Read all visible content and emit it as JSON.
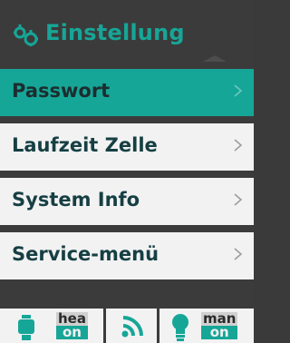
{
  "header": {
    "title": "Einstellung",
    "icon": "gears-icon"
  },
  "menu": {
    "items": [
      {
        "label": "Passwort",
        "active": true
      },
      {
        "label": "Laufzeit Zelle",
        "active": false
      },
      {
        "label": "System Info",
        "active": false
      },
      {
        "label": "Service-menü",
        "active": false
      }
    ]
  },
  "footer": {
    "status1": {
      "icon": "flask-icon",
      "top": "hea",
      "bottom": "on"
    },
    "status2": {
      "icon": "wireless-icon"
    },
    "status3": {
      "icon": "lightbulb-icon",
      "top": "man",
      "bottom": "on"
    }
  },
  "colors": {
    "accent": "#16a697",
    "background": "#3b3b3b",
    "item_bg": "#f2f2f2",
    "text": "#163f43"
  }
}
